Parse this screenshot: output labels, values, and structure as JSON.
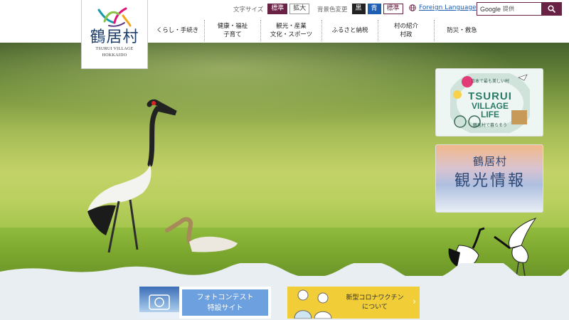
{
  "logo": {
    "name": "鶴居村",
    "sub1": "TSURUI VILLAGE",
    "sub2": "HOKKAIDO"
  },
  "utility": {
    "font_size_label": "文字サイズ",
    "font_standard": "標準",
    "font_large": "拡大",
    "bg_color_label": "背景色変更",
    "bg_black": "黒",
    "bg_blue": "青",
    "bg_standard": "標準",
    "foreign_language": "Foreign Language"
  },
  "search": {
    "brand": "Google",
    "placeholder": "提供"
  },
  "nav": [
    {
      "line1": "くらし・手続き",
      "line2": ""
    },
    {
      "line1": "健康・福祉",
      "line2": "子育て"
    },
    {
      "line1": "観光・産業",
      "line2": "文化・スポーツ"
    },
    {
      "line1": "ふるさと納税",
      "line2": ""
    },
    {
      "line1": "村の紹介",
      "line2": "村政"
    },
    {
      "line1": "防災・救急",
      "line2": ""
    }
  ],
  "banners": {
    "life": {
      "arc_text": "日本で最も美しい村",
      "line1": "TSURUI",
      "line2": "VILLAGE",
      "line3": "LIFE",
      "bottom": "鶴居村で暮らそう"
    },
    "kanko": {
      "line1": "鶴居村",
      "line2": "観光情報"
    }
  },
  "footer_banners": {
    "photo": {
      "line1": "フォトコンテスト",
      "line2": "特設サイト"
    },
    "vaccine": {
      "line1": "新型コロナワクチン",
      "line2": "について"
    }
  },
  "colors": {
    "brand": "#6a2244",
    "nav_text": "#222222",
    "link": "#1f5fb2"
  }
}
